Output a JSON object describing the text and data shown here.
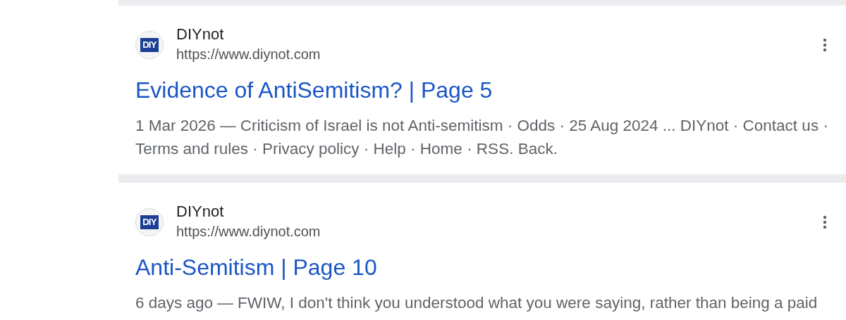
{
  "results": [
    {
      "site_name": "DIYnot",
      "favicon_text": "DIY",
      "url": "https://www.diynot.com",
      "title": "Evidence of AntiSemitism? | Page 5",
      "snippet": "1 Mar 2026 — Criticism of Israel is not Anti-semitism · Odds · 25 Aug 2024 ... DIYnot · Contact us · Terms and rules · Privacy policy · Help · Home · RSS. Back."
    },
    {
      "site_name": "DIYnot",
      "favicon_text": "DIY",
      "url": "https://www.diynot.com",
      "title": "Anti-Semitism | Page 10",
      "snippet": "6 days ago — FWIW, I don't think you understood what you were saying, rather than being a paid"
    }
  ]
}
